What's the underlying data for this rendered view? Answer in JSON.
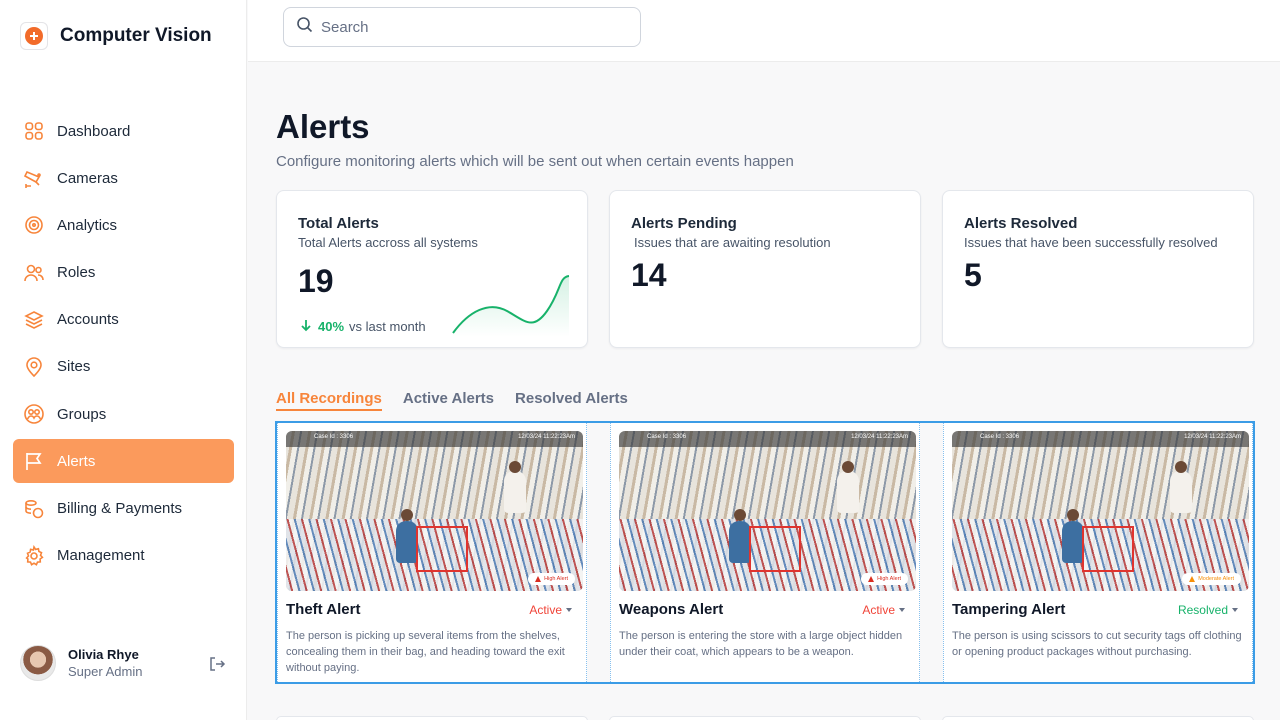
{
  "brand": {
    "title": "Computer Vision"
  },
  "sidebar": {
    "items": [
      {
        "label": "Dashboard",
        "icon": "grid-icon"
      },
      {
        "label": "Cameras",
        "icon": "camera-icon"
      },
      {
        "label": "Analytics",
        "icon": "target-icon"
      },
      {
        "label": "Roles",
        "icon": "users-icon"
      },
      {
        "label": "Accounts",
        "icon": "layers-icon"
      },
      {
        "label": "Sites",
        "icon": "location-icon"
      },
      {
        "label": "Groups",
        "icon": "groups-icon"
      },
      {
        "label": "Alerts",
        "icon": "flag-icon",
        "active": true
      },
      {
        "label": "Billing & Payments",
        "icon": "coins-icon"
      },
      {
        "label": "Management",
        "icon": "settings-icon"
      }
    ],
    "user": {
      "name": "Olivia Rhye",
      "role": "Super Admin"
    }
  },
  "search": {
    "placeholder": "Search"
  },
  "page": {
    "title": "Alerts",
    "subtitle": "Configure monitoring alerts which will be sent out when certain events happen"
  },
  "stats": [
    {
      "title": "Total Alerts",
      "subtitle": "Total Alerts accross all systems",
      "value": "19",
      "trend_pct": "40%",
      "trend_text": "vs last month"
    },
    {
      "title": "Alerts Pending",
      "subtitle": "Issues that are awaiting resolution",
      "value": "14"
    },
    {
      "title": "Alerts Resolved",
      "subtitle": "Issues that have been successfully resolved",
      "value": "5"
    }
  ],
  "tabs": [
    "All Recordings",
    "Active Alerts",
    "Resolved Alerts"
  ],
  "cards": [
    {
      "case": "Case Id : 3306",
      "time": "12/03/24 11:22:23Am",
      "badge": "High Alert",
      "title": "Theft Alert",
      "status": "Active",
      "description": "The person is picking up several items from the shelves, concealing them in their bag, and heading toward the exit without paying."
    },
    {
      "case": "Case Id : 3306",
      "time": "12/03/24 11:22:23Am",
      "badge": "High Alert",
      "title": "Weapons Alert",
      "status": "Active",
      "description": "The person is entering the store with a large object hidden under their coat, which appears to be a weapon."
    },
    {
      "case": "Case Id : 3306",
      "time": "12/03/24 11:22:23Am",
      "badge": "Moderate Alert",
      "title": "Tampering Alert",
      "status": "Resolved",
      "description": "The person is using scissors to cut security tags off clothing or opening product packages without purchasing."
    }
  ],
  "colors": {
    "accent": "#f7853b",
    "active_nav": "#fb9a5c",
    "positive": "#17b26a",
    "danger": "#f04438",
    "selection": "#3b9ce6"
  }
}
